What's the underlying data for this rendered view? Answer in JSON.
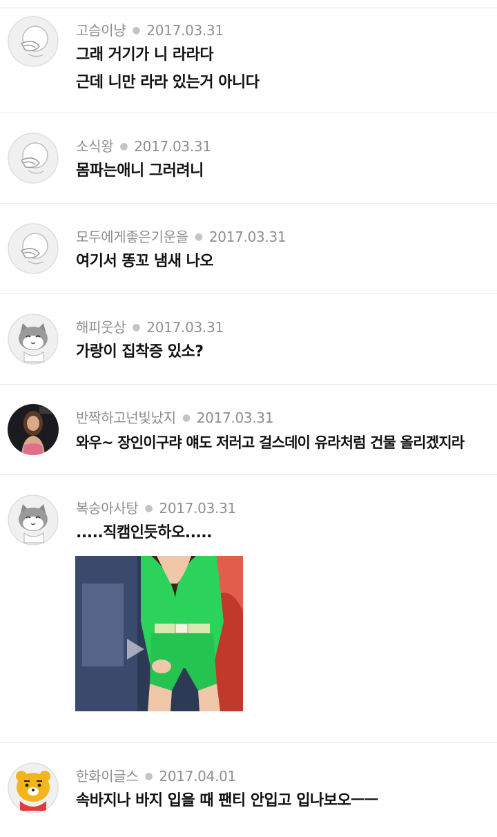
{
  "comments": [
    {
      "author": "고슴이냥",
      "date": "2017.03.31",
      "lines": [
        "그래 거기가 니 라라다",
        "근데 니만 라라 있는거 아니다"
      ],
      "avatar": "default-face-icon"
    },
    {
      "author": "소식왕",
      "date": "2017.03.31",
      "lines": [
        "몸파는애니 그러려니"
      ],
      "avatar": "default-face-icon"
    },
    {
      "author": "모두에게좋은기운을",
      "date": "2017.03.31",
      "lines": [
        "여기서 똥꼬 냄새 나오"
      ],
      "avatar": "default-face-icon"
    },
    {
      "author": "해피웃상",
      "date": "2017.03.31",
      "lines": [
        "가랑이 집착증 있소?"
      ],
      "avatar": "cat-face-icon"
    },
    {
      "author": "반짝하고넌빛났지",
      "date": "2017.03.31",
      "lines": [
        "와우~ 장인이구랴 얘도 저러고 걸스데이 유라처럼 건물 올리겠지라"
      ],
      "avatar": "photo-avatar"
    },
    {
      "author": "복숭아사탕",
      "date": "2017.03.31",
      "lines": [
        ".....직캠인듯하오....."
      ],
      "avatar": "cat-face-icon",
      "attachment": "photo-thumbnail"
    },
    {
      "author": "한화이글스",
      "date": "2017.04.01",
      "lines": [
        "속바지나 바지 입을 때 팬티 안입고 입나보오ㅡㅡ"
      ],
      "avatar": "bear-character-icon"
    }
  ],
  "colors": {
    "author": "#8e8e8e",
    "text": "#111111",
    "divider": "#e8e8e8",
    "avatar_bg": "#f0f0f0",
    "bear_yellow": "#f4b41c",
    "thumb_green": "#2bd35a"
  }
}
